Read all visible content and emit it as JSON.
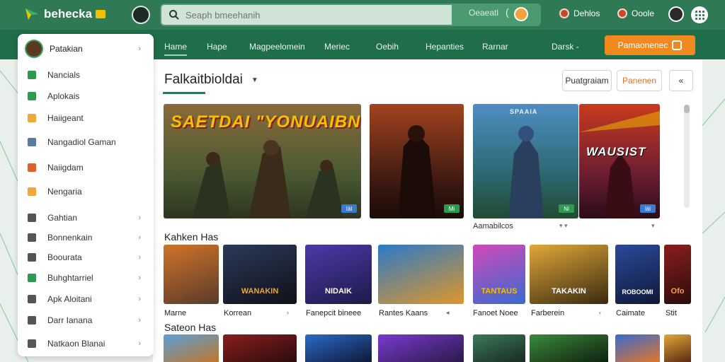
{
  "app": {
    "brand": "behecka"
  },
  "search": {
    "placeholder": "Seaph bmeehanih",
    "button_label": "Oeaeatl",
    "paren": "("
  },
  "top_links": [
    {
      "label": "Dehlos"
    },
    {
      "label": "Ooole"
    }
  ],
  "nav": {
    "items": [
      "Hame",
      "Hape",
      "Magpeelomein",
      "Meriec",
      "Oebih",
      "Hepanties",
      "Rarnar",
      "Darsk -"
    ],
    "cta_label": "Pamaonenec"
  },
  "sidebar": {
    "header": "Patakian",
    "items": [
      {
        "label": "Nancials",
        "color": "#2e9a4f",
        "chevron": false
      },
      {
        "label": "Aplokais",
        "color": "#2e9a4f",
        "chevron": false
      },
      {
        "label": "Haiigeant",
        "color": "#f0a83a",
        "chevron": false
      },
      {
        "label": "Nangadiol Gaman",
        "color": "#5a7aa0",
        "chevron": false
      },
      {
        "label": "Naiigdam",
        "color": "#e0602a",
        "chevron": false
      },
      {
        "label": "Nengaria",
        "color": "#f0a83a",
        "chevron": false
      },
      {
        "label": "Gahtian",
        "color": "#555",
        "chevron": true
      },
      {
        "label": "Bonnenkain",
        "color": "#555",
        "chevron": true
      },
      {
        "label": "Boourata",
        "color": "#555",
        "chevron": true
      },
      {
        "label": "Buhghtarriel",
        "color": "#2e9a4f",
        "chevron": true
      },
      {
        "label": "Apk Aloitani",
        "color": "#555",
        "chevron": true
      },
      {
        "label": "Darr Ianana",
        "color": "#555",
        "chevron": true
      },
      {
        "label": "Natkaon Blanai",
        "color": "#555",
        "chevron": true
      }
    ]
  },
  "main": {
    "heading": "Falkaitbioldai",
    "tools": [
      "Puatgraiam",
      "Panenen",
      "«"
    ],
    "featured": [
      {
        "title": "SAETDAI \"YONUAIBN",
        "tag": "Iäl"
      },
      {
        "title": "",
        "tag": "Mi"
      },
      {
        "title": "SPAAIA",
        "tag": "Ni"
      },
      {
        "title": "WAUSIST",
        "tag": "läl"
      }
    ],
    "featured_caption": "Aamabilcos",
    "featured_markers": [
      "▾ ▾",
      "▾"
    ],
    "section1": "Kahken Has",
    "thumbs": [
      {
        "title": "",
        "caption": "Marne"
      },
      {
        "title": "WANAKIN",
        "caption": "Korrean",
        "marker": "›"
      },
      {
        "title": "NIDAIK",
        "caption": "Fanepcit bineee"
      },
      {
        "title": "",
        "caption": "Rantes Kaans",
        "marker": "◂"
      },
      {
        "title": "TANTAUS",
        "caption": "Fanoet Noee"
      },
      {
        "title": "TAKAKIN",
        "caption": "Farberein",
        "marker": "‹"
      },
      {
        "title": "ROBOOMI",
        "caption": "Caimate"
      },
      {
        "title": "Ofo",
        "caption": "Stit"
      }
    ],
    "section2": "Sateon Has"
  }
}
